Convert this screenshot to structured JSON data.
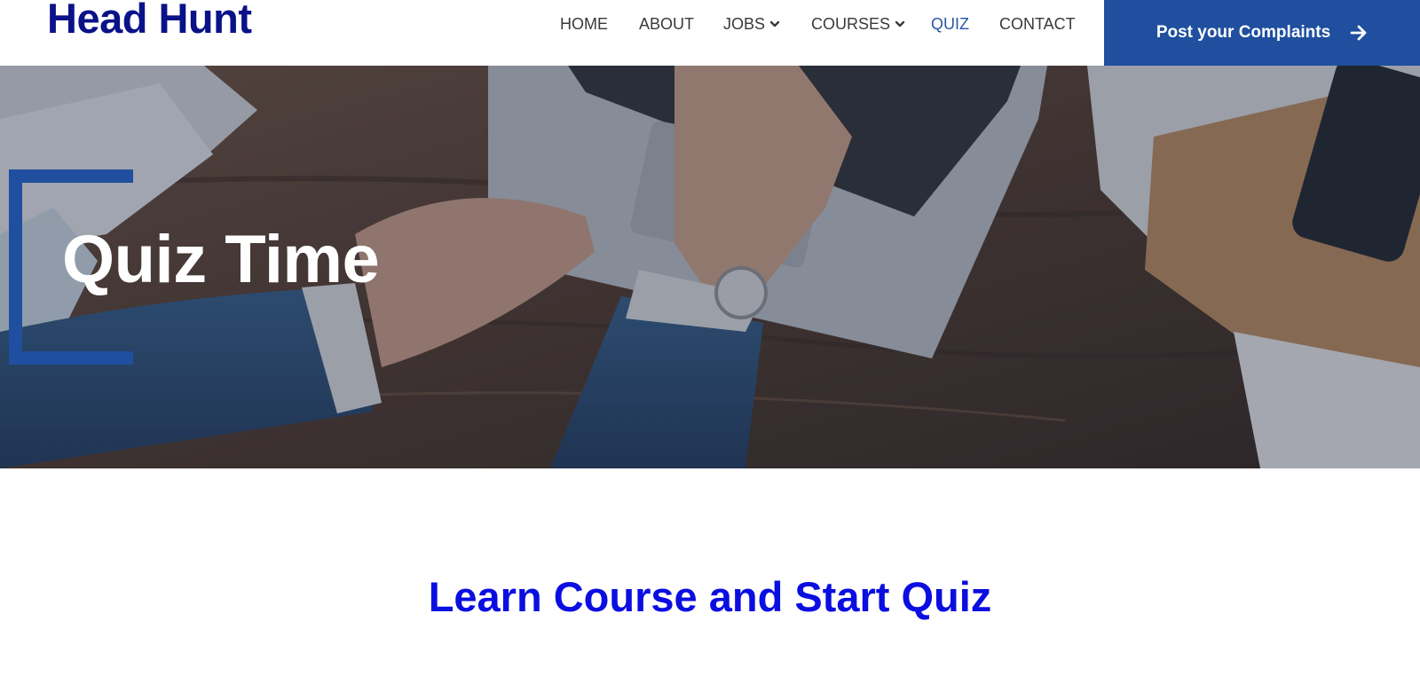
{
  "header": {
    "logo": "Head Hunt",
    "nav": [
      {
        "label": "HOME",
        "has_dropdown": false,
        "active": false
      },
      {
        "label": "ABOUT",
        "has_dropdown": false,
        "active": false
      },
      {
        "label": "JOBS",
        "has_dropdown": true,
        "active": false
      },
      {
        "label": "COURSES",
        "has_dropdown": true,
        "active": false
      },
      {
        "label": "QUIZ",
        "has_dropdown": false,
        "active": true
      },
      {
        "label": "CONTACT",
        "has_dropdown": false,
        "active": false
      }
    ],
    "cta_label": "Post your Complaints",
    "cta_icon": "arrow-right-icon"
  },
  "hero": {
    "title": "Quiz Time",
    "image": "business-desk-laptop-photo"
  },
  "section": {
    "heading": "Learn Course and Start Quiz"
  },
  "colors": {
    "brand_dark": "#0a1288",
    "accent": "#1f4f9e",
    "active_nav": "#2a56a4",
    "heading_blue": "#0b0ee0"
  }
}
